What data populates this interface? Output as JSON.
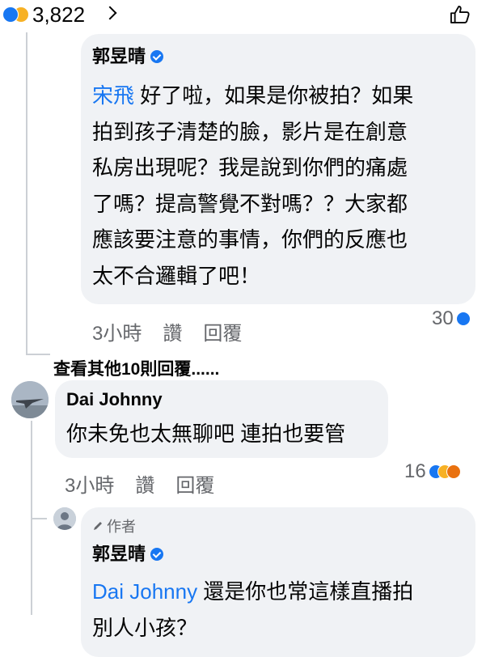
{
  "top_bar": {
    "reaction_count": "3,822",
    "reactions": [
      "like",
      "wow"
    ]
  },
  "comments": [
    {
      "author": "郭昱晴",
      "verified": true,
      "mention": "宋飛",
      "lines": [
        " 好了啦，如果是你被拍？如果",
        "拍到孩子清楚的臉，影片是在創意",
        "私房出現呢？我是說到你們的痛處",
        "了嗎？提高警覺不對嗎？？大家都",
        "應該要注意的事情，你們的反應也",
        "太不合邏輯了吧！"
      ],
      "time": "3小時",
      "like_label": "讚",
      "reply_label": "回覆",
      "reaction_count": "30",
      "reactions": [
        "like"
      ]
    },
    {
      "author": "Dai Johnny",
      "text": "你未免也太無聊吧 連拍也要管",
      "time": "3小時",
      "like_label": "讚",
      "reply_label": "回覆",
      "reaction_count": "16",
      "reactions": [
        "like",
        "wow",
        "angry"
      ]
    },
    {
      "author_badge": "作者",
      "author": "郭昱晴",
      "verified": true,
      "mention": "Dai Johnny",
      "lines": [
        " 還是你也常這樣直播拍",
        "別人小孩？"
      ]
    }
  ],
  "view_more_replies": "查看其他10則回覆......",
  "colors": {
    "bubble": "#f0f2f5",
    "accent": "#1877f2",
    "meta": "#65676b"
  },
  "icons": {
    "top_right": "thumbs-up-outline-icon",
    "author_badge": "pencil-icon"
  }
}
